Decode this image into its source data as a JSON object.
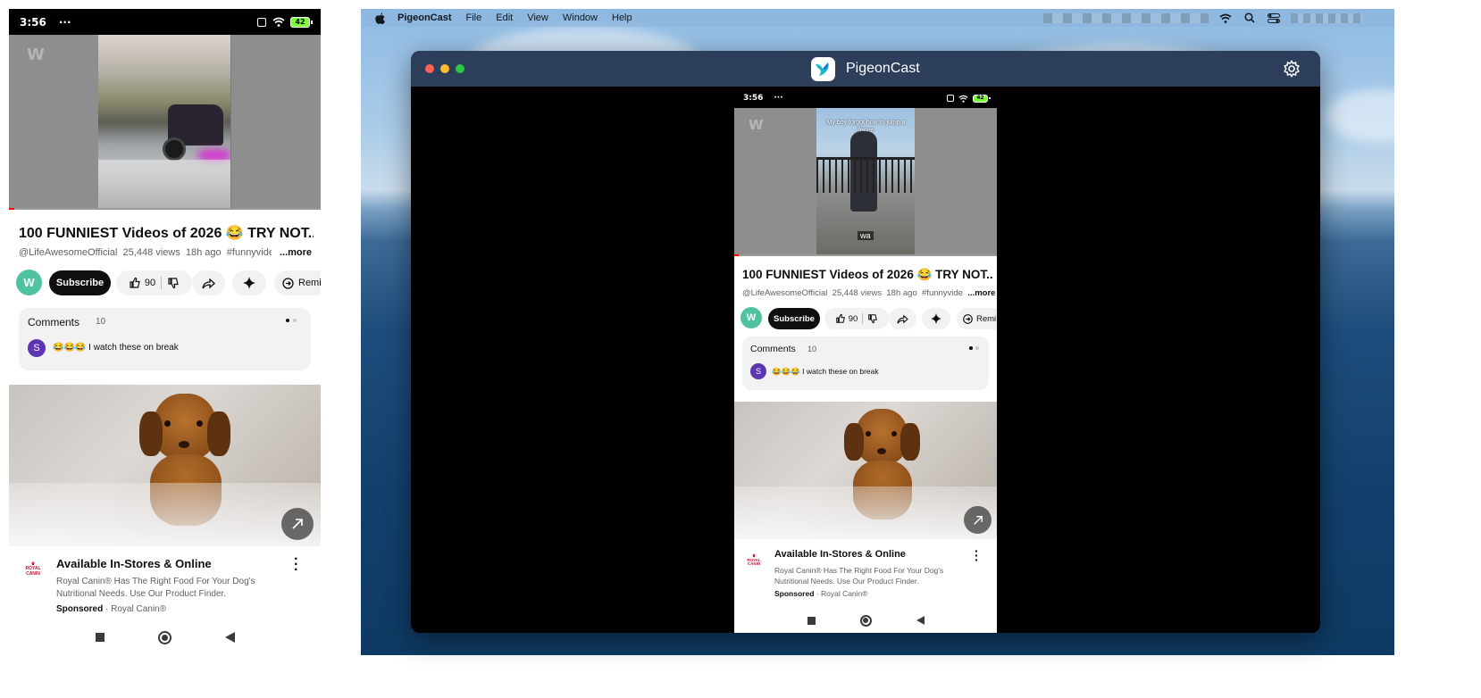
{
  "phone": {
    "status_time": "3:56",
    "status_dots": "···",
    "battery": "42",
    "video_watermark": "W",
    "mirror_video_caption": "My boy forgot how to jump a fence",
    "mirror_video_subtitle": "wa",
    "video_title": "100 FUNNIEST Videos of 2026 😂 TRY NOT...",
    "channel": "@LifeAwesomeOfficial",
    "views": "25,448 views",
    "age": "18h ago",
    "hashtag": "#funnyvideo",
    "more_label": "...more",
    "subscribe_label": "Subscribe",
    "like_count": "90",
    "remix_label": "Remi",
    "comments_label": "Comments",
    "comments_count": "10",
    "comment_avatar": "S",
    "comment_text": "😂😂😂 I watch these on break",
    "ad_title": "Available In-Stores & Online",
    "ad_desc_line1": "Royal Canin® Has The Right Food For Your Dog's",
    "ad_desc_line2": "Nutritional Needs. Use Our Product Finder.",
    "ad_sponsored": "Sponsored",
    "ad_advertiser": "· Royal Canin®",
    "ad_logo_line1": "ROYAL",
    "ad_logo_line2": "CANIN"
  },
  "mac": {
    "menu": {
      "app": "PigeonCast",
      "file": "File",
      "edit": "Edit",
      "view": "View",
      "window": "Window",
      "help": "Help"
    },
    "window_title": "PigeonCast"
  },
  "colors": {
    "accent_subscribe": "#0f0f0f",
    "titlebar": "#2c3e5a",
    "battery": "#7CFC3C",
    "comment_avatar": "#5e35b1",
    "channel_avatar": "#4fc3a1",
    "royal_canin_red": "#c4122f"
  },
  "icons": [
    "apple-icon",
    "wifi-icon",
    "search-icon",
    "control-center-icon",
    "gear-icon",
    "thumb-up-icon",
    "thumb-down-icon",
    "share-icon",
    "sparkle-icon",
    "remix-icon",
    "expand-arrow-icon",
    "kebab-icon",
    "nav-square-icon",
    "nav-circle-icon",
    "nav-back-icon"
  ]
}
